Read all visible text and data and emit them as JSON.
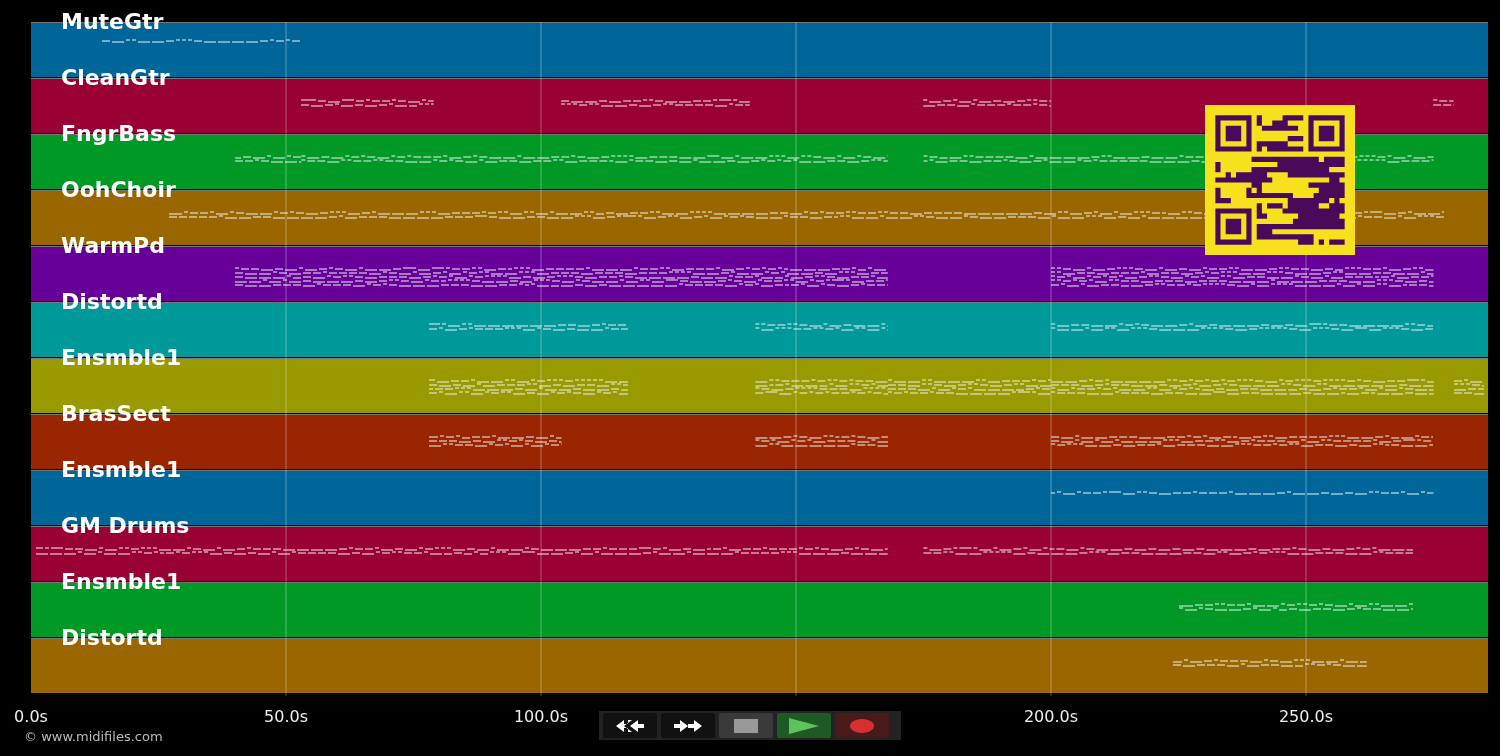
{
  "tracks": [
    {
      "name": "MuteGtr",
      "color": "#006699"
    },
    {
      "name": "CleanGtr",
      "color": "#990033"
    },
    {
      "name": "FngrBass",
      "color": "#009926"
    },
    {
      "name": "OohChoir",
      "color": "#996600"
    },
    {
      "name": "WarmPd",
      "color": "#660099"
    },
    {
      "name": "Distortd",
      "color": "#009999"
    },
    {
      "name": "Ensmble1",
      "color": "#999900"
    },
    {
      "name": "BrasSect",
      "color": "#992600"
    },
    {
      "name": "Ensmble1",
      "color": "#006699"
    },
    {
      "name": "GM Drums",
      "color": "#990033"
    },
    {
      "name": "Ensmble1",
      "color": "#009926"
    },
    {
      "name": "Distortd",
      "color": "#996600"
    }
  ],
  "axis": {
    "ticks": [
      "0.0s",
      "50.0s",
      "100.0s",
      "200.0s",
      "250.0s"
    ]
  },
  "controls": [
    {
      "kind": "rewind"
    },
    {
      "kind": "forward"
    },
    {
      "kind": "stop"
    },
    {
      "kind": "play"
    },
    {
      "kind": "record"
    }
  ],
  "footer": "© www.midifiles.com"
}
